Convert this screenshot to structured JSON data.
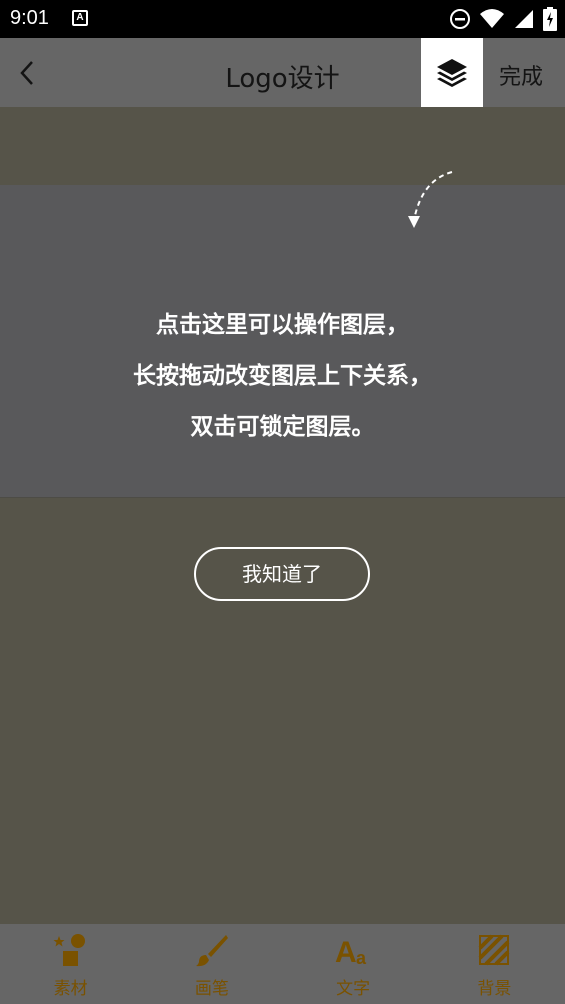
{
  "status_bar": {
    "time": "9:01",
    "notification_icon_letter": "A"
  },
  "app_bar": {
    "title": "Logo设计",
    "done_label": "完成"
  },
  "tip": {
    "lines": [
      "点击这里可以操作图层，",
      "长按拖动改变图层上下关系，",
      "双击可锁定图层。"
    ],
    "button_label": "我知道了"
  },
  "toolbar": {
    "items": [
      {
        "label": "素材",
        "icon": "material-icon"
      },
      {
        "label": "画笔",
        "icon": "brush-icon"
      },
      {
        "label": "文字",
        "icon": "text-icon"
      },
      {
        "label": "背景",
        "icon": "background-icon"
      }
    ]
  },
  "colors": {
    "accent": "#7a5200",
    "overlay": "#565449",
    "app_bar": "#666666"
  }
}
